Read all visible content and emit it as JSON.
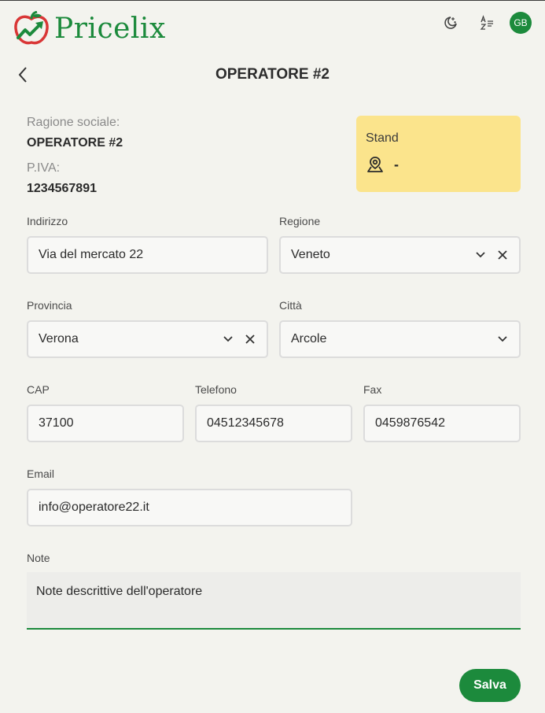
{
  "app": {
    "name": "Pricelix",
    "brand_color": "#1c8a3c",
    "avatar_initials": "GB"
  },
  "header": {
    "icons": [
      "moon-icon",
      "translate-icon"
    ]
  },
  "page": {
    "title": "OPERATORE #2"
  },
  "info": {
    "ragione_label": "Ragione sociale:",
    "ragione_value": "OPERATORE #2",
    "piva_label": "P.IVA:",
    "piva_value": "1234567891"
  },
  "stand": {
    "label": "Stand",
    "value": "-",
    "color": "#fbe48c"
  },
  "form": {
    "indirizzo": {
      "label": "Indirizzo",
      "value": "Via del mercato 22"
    },
    "regione": {
      "label": "Regione",
      "value": "Veneto"
    },
    "provincia": {
      "label": "Provincia",
      "value": "Verona"
    },
    "citta": {
      "label": "Città",
      "value": "Arcole"
    },
    "cap": {
      "label": "CAP",
      "value": "37100"
    },
    "telefono": {
      "label": "Telefono",
      "value": "04512345678"
    },
    "fax": {
      "label": "Fax",
      "value": "0459876542"
    },
    "email": {
      "label": "Email",
      "value": "info@operatore22.it"
    },
    "note": {
      "label": "Note",
      "value": "Note descrittive dell'operatore"
    }
  },
  "actions": {
    "save_label": "Salva"
  }
}
